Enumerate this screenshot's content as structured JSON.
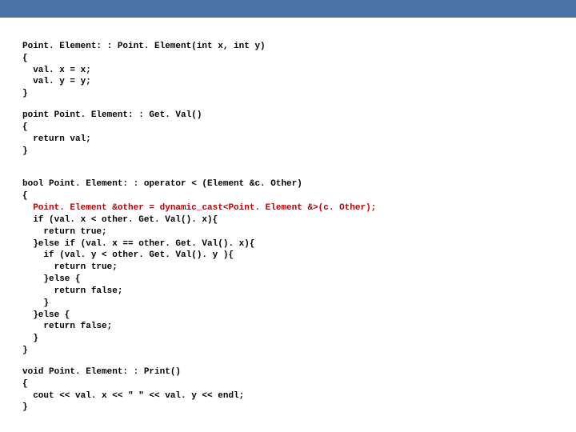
{
  "code": {
    "ctor": {
      "l1": "Point. Element: : Point. Element(int x, int y)",
      "l2": "{",
      "l3": "  val. x = x;",
      "l4": "  val. y = y;",
      "l5": "}"
    },
    "getval": {
      "l1": "point Point. Element: : Get. Val()",
      "l2": "{",
      "l3": "  return val;",
      "l4": "}"
    },
    "oplt": {
      "l1": "bool Point. Element: : operator < (Element &c. Other)",
      "l2": "{",
      "l3a": "  ",
      "l3b": "Point. Element &other = dynamic_cast<Point. Element &>(c. Other);",
      "l4": "  if (val. x < other. Get. Val(). x){",
      "l5": "    return true;",
      "l6": "  }else if (val. x == other. Get. Val(). x){",
      "l7": "    if (val. y < other. Get. Val(). y ){",
      "l8": "      return true;",
      "l9": "    }else {",
      "l10": "      return false;",
      "l11": "    }",
      "l12": "  }else {",
      "l13": "    return false;",
      "l14": "  }",
      "l15": "}"
    },
    "print": {
      "l1": "void Point. Element: : Print()",
      "l2": "{",
      "l3": "  cout << val. x << \" \" << val. y << endl;",
      "l4": "}"
    }
  }
}
